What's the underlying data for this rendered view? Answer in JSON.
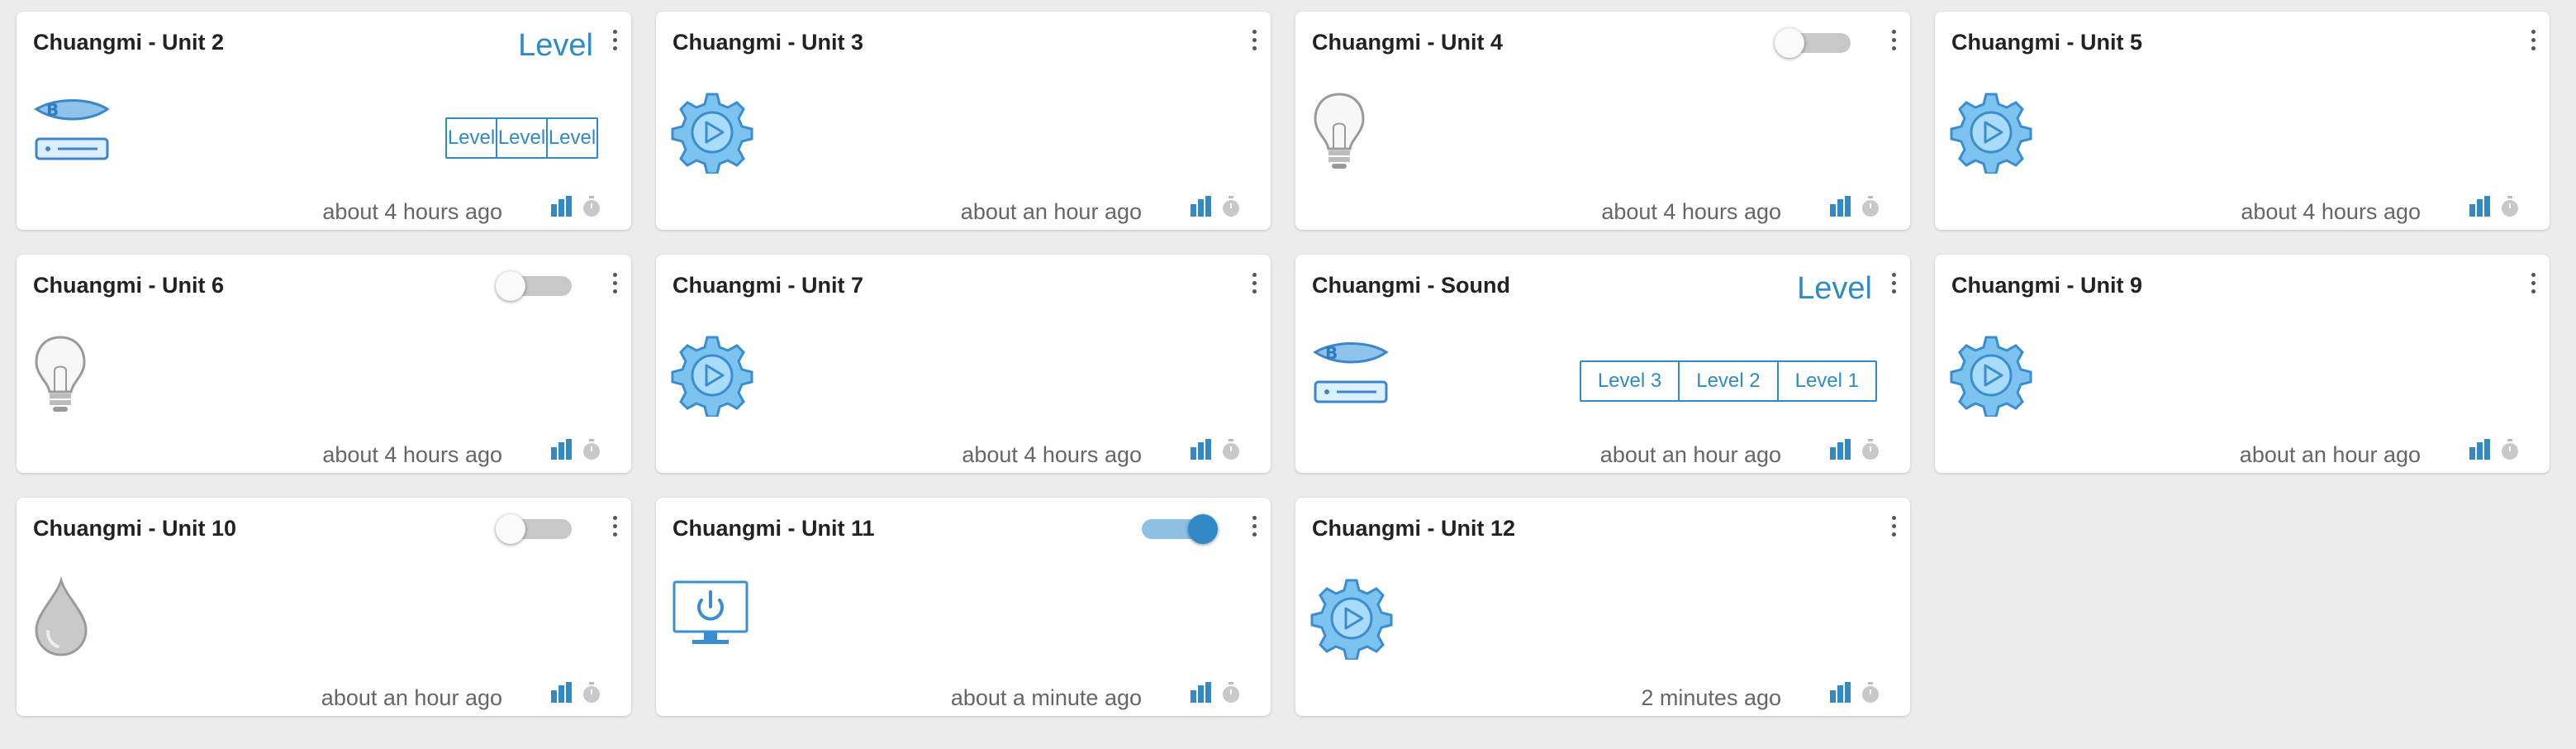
{
  "colors": {
    "accent": "#2f8ac6",
    "background": "#ececec",
    "card": "#ffffff"
  },
  "cards": [
    {
      "title": "Chuangmi - Unit 2",
      "icon": "bluray-player-icon",
      "level_text": "Level",
      "levels": [
        "Level",
        "Level",
        "Level"
      ],
      "timestamp": "about 4 hours ago"
    },
    {
      "title": "Chuangmi - Unit 3",
      "icon": "gear-play-icon",
      "timestamp": "about an hour ago"
    },
    {
      "title": "Chuangmi - Unit 4",
      "icon": "lightbulb-icon",
      "toggle": "off",
      "timestamp": "about 4 hours ago"
    },
    {
      "title": "Chuangmi - Unit 5",
      "icon": "gear-play-icon",
      "timestamp": "about 4 hours ago"
    },
    {
      "title": "Chuangmi - Unit 6",
      "icon": "lightbulb-icon",
      "toggle": "off",
      "timestamp": "about 4 hours ago"
    },
    {
      "title": "Chuangmi - Unit 7",
      "icon": "gear-play-icon",
      "timestamp": "about 4 hours ago"
    },
    {
      "title": "Chuangmi - Sound",
      "icon": "bluray-player-icon",
      "level_text": "Level",
      "levels": [
        "Level 3",
        "Level 2",
        "Level 1"
      ],
      "timestamp": "about an hour ago"
    },
    {
      "title": "Chuangmi - Unit 9",
      "icon": "gear-play-icon",
      "timestamp": "about an hour ago"
    },
    {
      "title": "Chuangmi - Unit 10",
      "icon": "water-drop-icon",
      "toggle": "off",
      "timestamp": "about an hour ago"
    },
    {
      "title": "Chuangmi - Unit 11",
      "icon": "monitor-power-icon",
      "toggle": "on",
      "timestamp": "about a minute ago"
    },
    {
      "title": "Chuangmi - Unit 12",
      "icon": "gear-play-icon",
      "timestamp": "2 minutes ago"
    }
  ]
}
